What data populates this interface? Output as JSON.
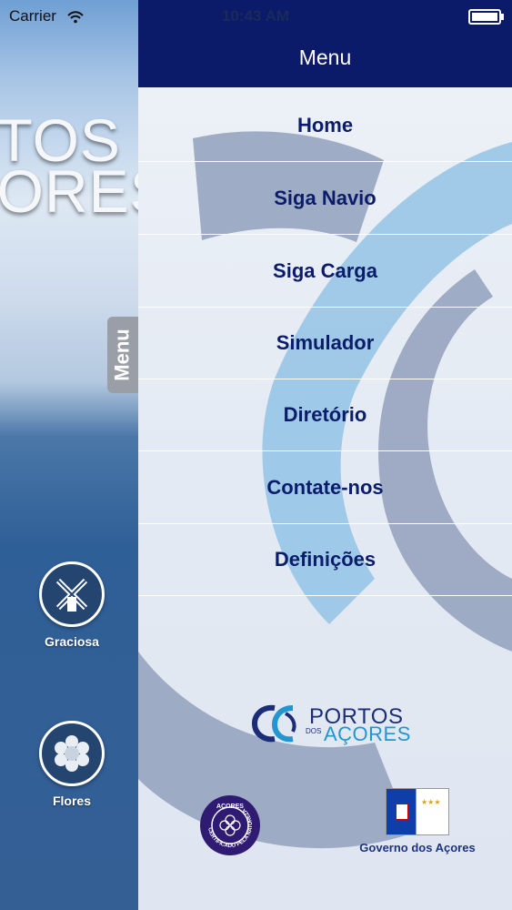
{
  "status_bar": {
    "carrier": "Carrier",
    "time": "10:43 AM"
  },
  "left_pane": {
    "background_logo_line1": "RTOS",
    "background_logo_line2": "ÇORES",
    "menu_tab_label": "Menu",
    "islands": [
      {
        "label": "Graciosa",
        "icon": "windmill-icon"
      },
      {
        "label": "Flores",
        "icon": "flower-icon"
      }
    ]
  },
  "menu": {
    "title": "Menu",
    "items": [
      {
        "label": "Home"
      },
      {
        "label": "Siga Navio"
      },
      {
        "label": "Siga Carga"
      },
      {
        "label": "Simulador"
      },
      {
        "label": "Diretório"
      },
      {
        "label": "Contate-nos"
      },
      {
        "label": "Definições"
      }
    ]
  },
  "brand": {
    "line1": "PORTOS",
    "small": "DOS",
    "line2": "AÇORES"
  },
  "seal": {
    "top_text": "AÇORES",
    "ring_text": "CERTIFICADO PELA NATUREZA"
  },
  "government": {
    "label": "Governo dos Açores"
  },
  "colors": {
    "header_bg": "#0c1a6a",
    "menu_text": "#0b1c6a",
    "brand_dark": "#1c2d78",
    "brand_light": "#2496cf"
  }
}
